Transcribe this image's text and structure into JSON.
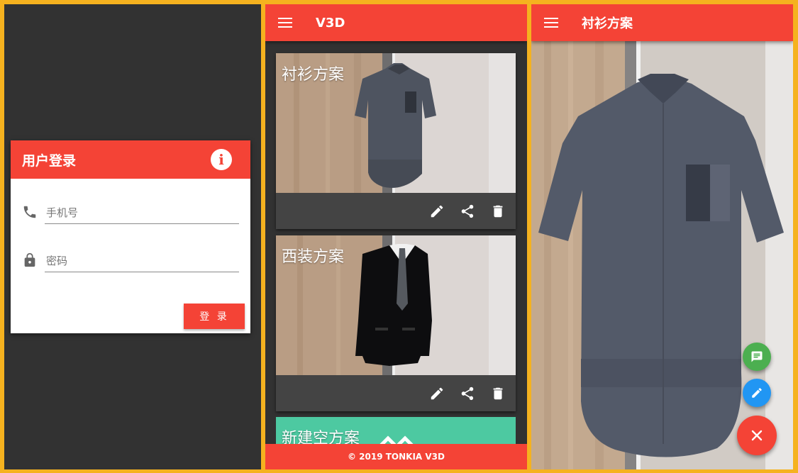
{
  "login": {
    "title": "用户登录",
    "phone_placeholder": "手机号",
    "password_placeholder": "密码",
    "submit_label": "登 录"
  },
  "list_screen": {
    "app_title": "V3D",
    "cards": [
      {
        "title": "衬衫方案"
      },
      {
        "title": "西装方案"
      },
      {
        "title": "新建空方案"
      }
    ],
    "footer": "© 2019 TONKIA V3D"
  },
  "detail_screen": {
    "title": "衬衫方案"
  },
  "colors": {
    "primary": "#f44336",
    "dark_bg": "#323232",
    "card_bar": "#444444",
    "new_card": "#4dc9a1",
    "fab_message": "#4caf50",
    "fab_edit": "#2196f3",
    "fab_close": "#f44336"
  },
  "icons": [
    "info-icon",
    "phone-icon",
    "lock-icon",
    "menu-icon",
    "edit-icon",
    "share-icon",
    "delete-icon",
    "message-icon",
    "close-icon"
  ]
}
